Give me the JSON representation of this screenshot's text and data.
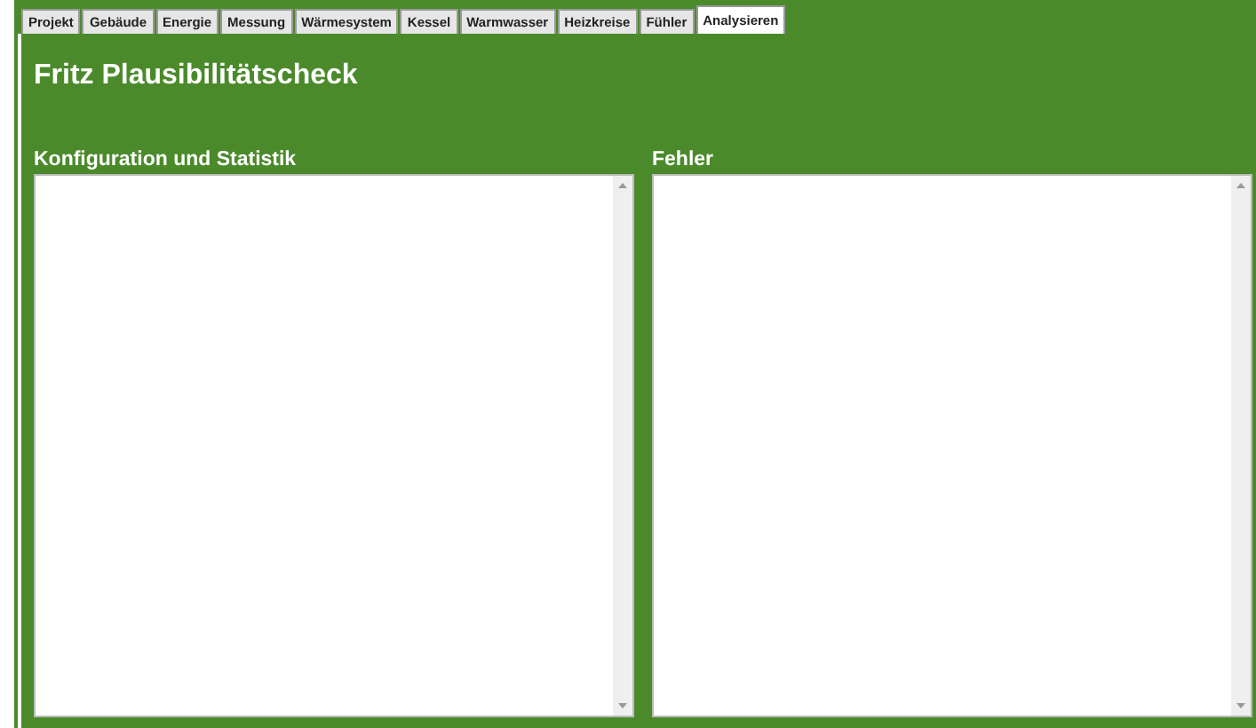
{
  "tabs": [
    {
      "label": "Projekt",
      "selected": false
    },
    {
      "label": "Gebäude",
      "selected": false
    },
    {
      "label": "Energie",
      "selected": false
    },
    {
      "label": "Messung",
      "selected": false
    },
    {
      "label": "Wärmesystem",
      "selected": false
    },
    {
      "label": "Kessel",
      "selected": false
    },
    {
      "label": "Warmwasser",
      "selected": false
    },
    {
      "label": "Heizkreise",
      "selected": false
    },
    {
      "label": "Fühler",
      "selected": false
    },
    {
      "label": "Analysieren",
      "selected": true
    }
  ],
  "title": "Fritz Plausibilitätscheck",
  "panels": [
    {
      "label": "Konfiguration und Statistik"
    },
    {
      "label": "Fehler"
    }
  ]
}
